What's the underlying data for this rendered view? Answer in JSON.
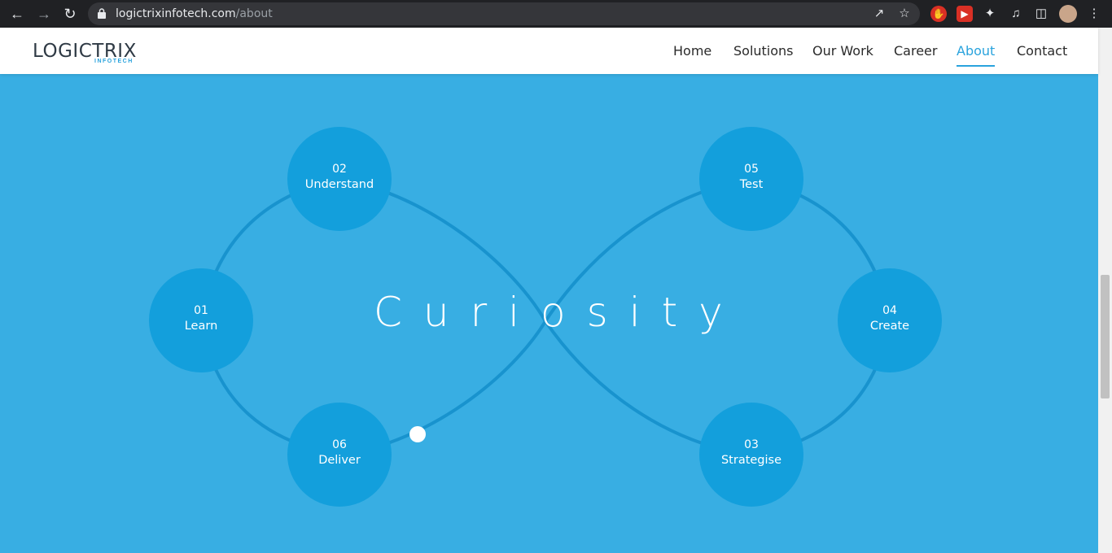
{
  "browser": {
    "url_domain": "logictrixinfotech.com",
    "url_path": "/about",
    "icons": [
      "back-icon",
      "forward-icon",
      "reload-icon",
      "lock-icon",
      "share-icon",
      "star-icon",
      "extension-icon",
      "puzzle-icon",
      "media-icon",
      "sidepanel-icon",
      "menu-icon"
    ]
  },
  "header": {
    "logo_main": "LOGICTRIX",
    "logo_sub": "INFOTECH",
    "nav": [
      "Home",
      "Solutions",
      "Our Work",
      "Career",
      "About",
      "Contact"
    ],
    "active": "About"
  },
  "hero": {
    "headline": "Curiosity",
    "steps": [
      {
        "num": "01",
        "label": "Learn"
      },
      {
        "num": "02",
        "label": "Understand"
      },
      {
        "num": "03",
        "label": "Strategise"
      },
      {
        "num": "04",
        "label": "Create"
      },
      {
        "num": "05",
        "label": "Test"
      },
      {
        "num": "06",
        "label": "Deliver"
      }
    ]
  },
  "colors": {
    "background": "#38aee3",
    "node": "#139fdc",
    "accent": "#2aa3dd",
    "line": "#1893ce"
  }
}
